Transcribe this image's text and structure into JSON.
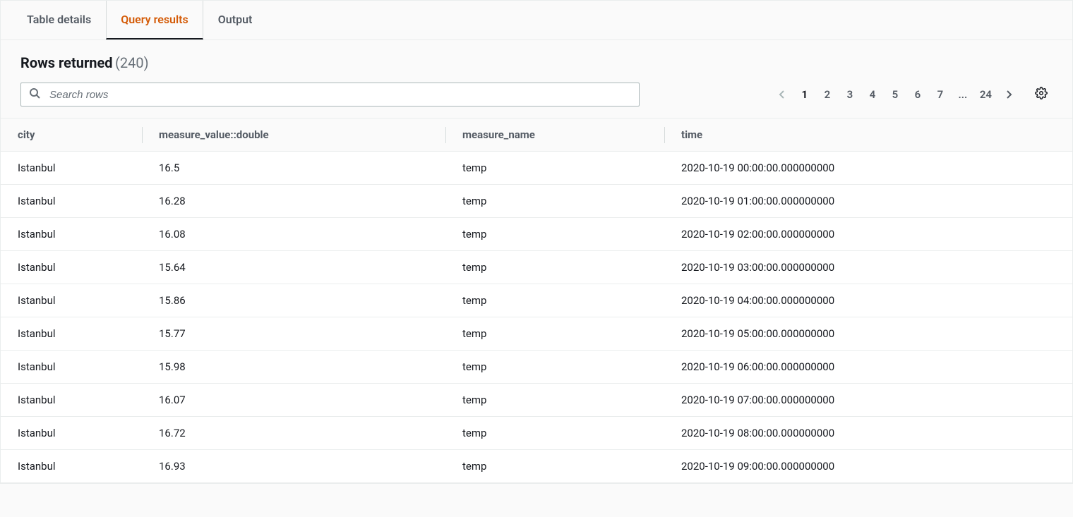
{
  "tabs": [
    {
      "label": "Table details",
      "active": false
    },
    {
      "label": "Query results",
      "active": true
    },
    {
      "label": "Output",
      "active": false
    }
  ],
  "results": {
    "title": "Rows returned",
    "count_display": "(240)"
  },
  "search": {
    "placeholder": "Search rows",
    "value": ""
  },
  "pagination": {
    "pages": [
      "1",
      "2",
      "3",
      "4",
      "5",
      "6",
      "7",
      "...",
      "24"
    ],
    "current": "1",
    "prev_disabled": true,
    "next_disabled": false
  },
  "columns": [
    "city",
    "measure_value::double",
    "measure_name",
    "time"
  ],
  "rows": [
    {
      "city": "Istanbul",
      "measure_value": "16.5",
      "measure_name": "temp",
      "time": "2020-10-19 00:00:00.000000000"
    },
    {
      "city": "Istanbul",
      "measure_value": "16.28",
      "measure_name": "temp",
      "time": "2020-10-19 01:00:00.000000000"
    },
    {
      "city": "Istanbul",
      "measure_value": "16.08",
      "measure_name": "temp",
      "time": "2020-10-19 02:00:00.000000000"
    },
    {
      "city": "Istanbul",
      "measure_value": "15.64",
      "measure_name": "temp",
      "time": "2020-10-19 03:00:00.000000000"
    },
    {
      "city": "Istanbul",
      "measure_value": "15.86",
      "measure_name": "temp",
      "time": "2020-10-19 04:00:00.000000000"
    },
    {
      "city": "Istanbul",
      "measure_value": "15.77",
      "measure_name": "temp",
      "time": "2020-10-19 05:00:00.000000000"
    },
    {
      "city": "Istanbul",
      "measure_value": "15.98",
      "measure_name": "temp",
      "time": "2020-10-19 06:00:00.000000000"
    },
    {
      "city": "Istanbul",
      "measure_value": "16.07",
      "measure_name": "temp",
      "time": "2020-10-19 07:00:00.000000000"
    },
    {
      "city": "Istanbul",
      "measure_value": "16.72",
      "measure_name": "temp",
      "time": "2020-10-19 08:00:00.000000000"
    },
    {
      "city": "Istanbul",
      "measure_value": "16.93",
      "measure_name": "temp",
      "time": "2020-10-19 09:00:00.000000000"
    }
  ]
}
